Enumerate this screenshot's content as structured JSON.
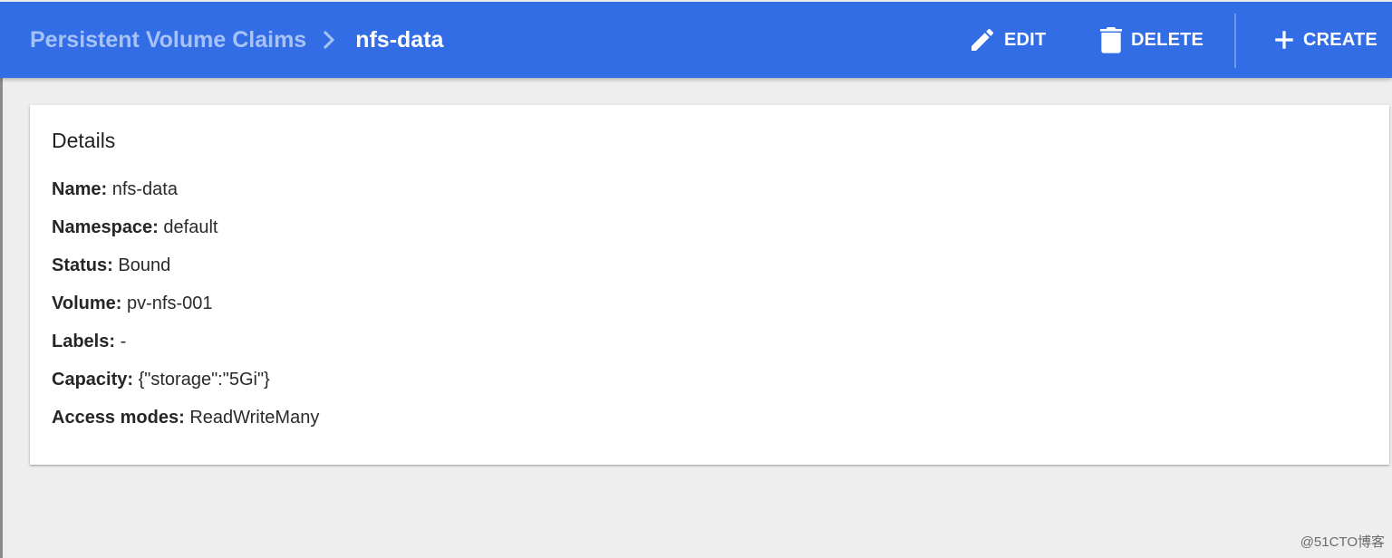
{
  "header": {
    "breadcrumb_parent": "Persistent Volume Claims",
    "breadcrumb_current": "nfs-data",
    "actions": {
      "edit": "EDIT",
      "delete": "DELETE",
      "create": "CREATE"
    }
  },
  "details": {
    "title": "Details",
    "rows": [
      {
        "label": "Name:",
        "value": "nfs-data"
      },
      {
        "label": "Namespace:",
        "value": "default"
      },
      {
        "label": "Status:",
        "value": "Bound"
      },
      {
        "label": "Volume:",
        "value": "pv-nfs-001"
      },
      {
        "label": "Labels:",
        "value": "-"
      },
      {
        "label": "Capacity:",
        "value": "{\"storage\":\"5Gi\"}"
      },
      {
        "label": "Access modes:",
        "value": "ReadWriteMany"
      }
    ]
  },
  "watermark": "@51CTO博客",
  "colors": {
    "toolbar": "#326de6",
    "breadcrumb_parent": "#a7c2f7",
    "background": "#eeeeee"
  },
  "icons": {
    "edit": "pencil-icon",
    "delete": "trash-icon",
    "create": "plus-icon",
    "separator": "chevron-right-icon"
  }
}
